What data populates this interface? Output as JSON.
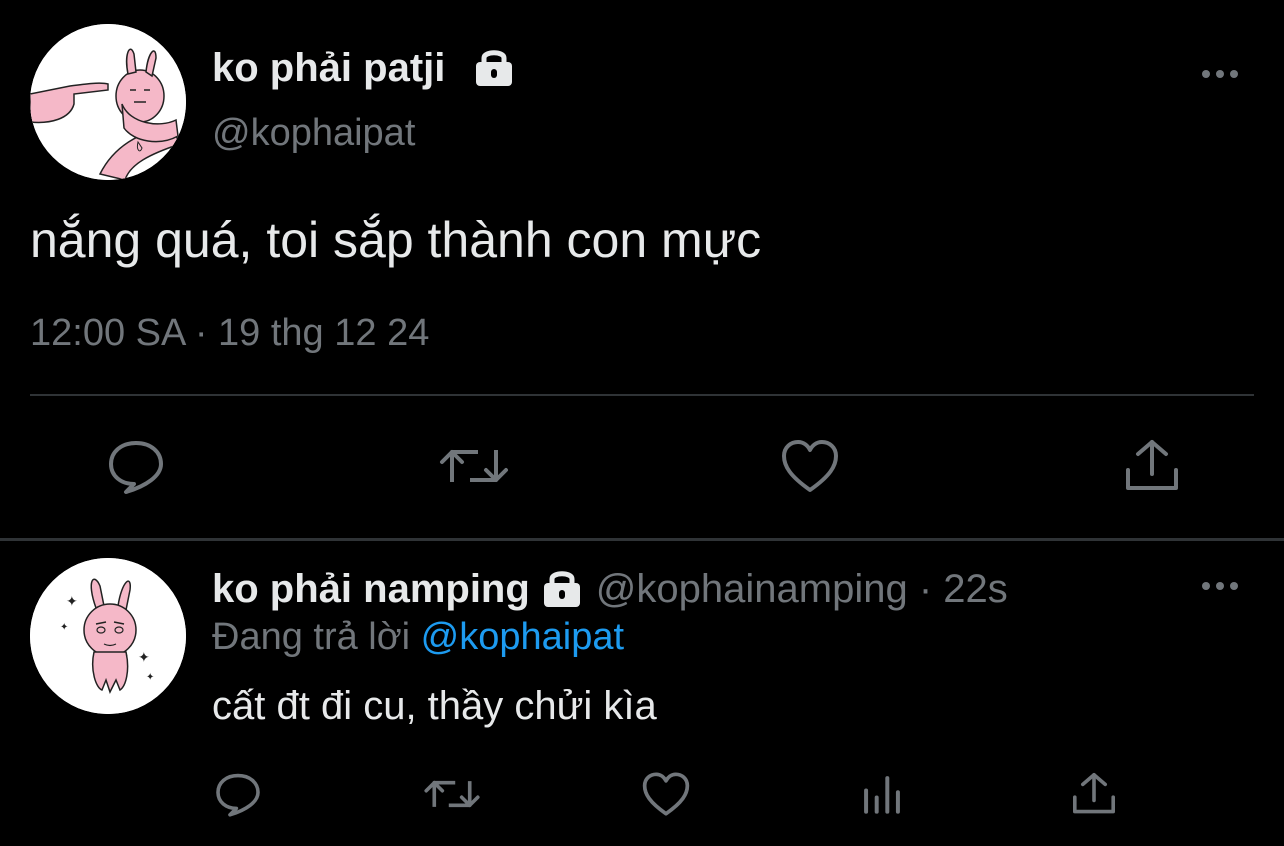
{
  "main_tweet": {
    "display_name": "ko phải patji",
    "handle": "@kophaipat",
    "text": "nắng quá, toi sắp thành con mực",
    "time": "12:00 SA",
    "separator": "·",
    "date": "19 thg 12 24",
    "icons": {
      "locked": "lock-icon",
      "more": "more-options-icon",
      "reply": "reply-icon",
      "retweet": "retweet-icon",
      "like": "like-icon",
      "share": "share-icon"
    }
  },
  "reply_tweet": {
    "display_name": "ko phải namping",
    "handle": "@kophainamping",
    "separator": "·",
    "time_ago": "22s",
    "replying_to_label": "Đang trả lời",
    "replying_to_handle": "@kophaipat",
    "text": "cất đt đi cu, thầy chửi kìa",
    "icons": {
      "locked": "lock-icon",
      "more": "more-options-icon",
      "reply": "reply-icon",
      "retweet": "retweet-icon",
      "like": "like-icon",
      "views": "views-icon",
      "share": "share-icon"
    }
  },
  "colors": {
    "background": "#000000",
    "text_primary": "#e7e9ea",
    "text_secondary": "#71767b",
    "link": "#1d9bf0",
    "divider": "#2f3336",
    "avatar_pink": "#f5b8c8"
  }
}
